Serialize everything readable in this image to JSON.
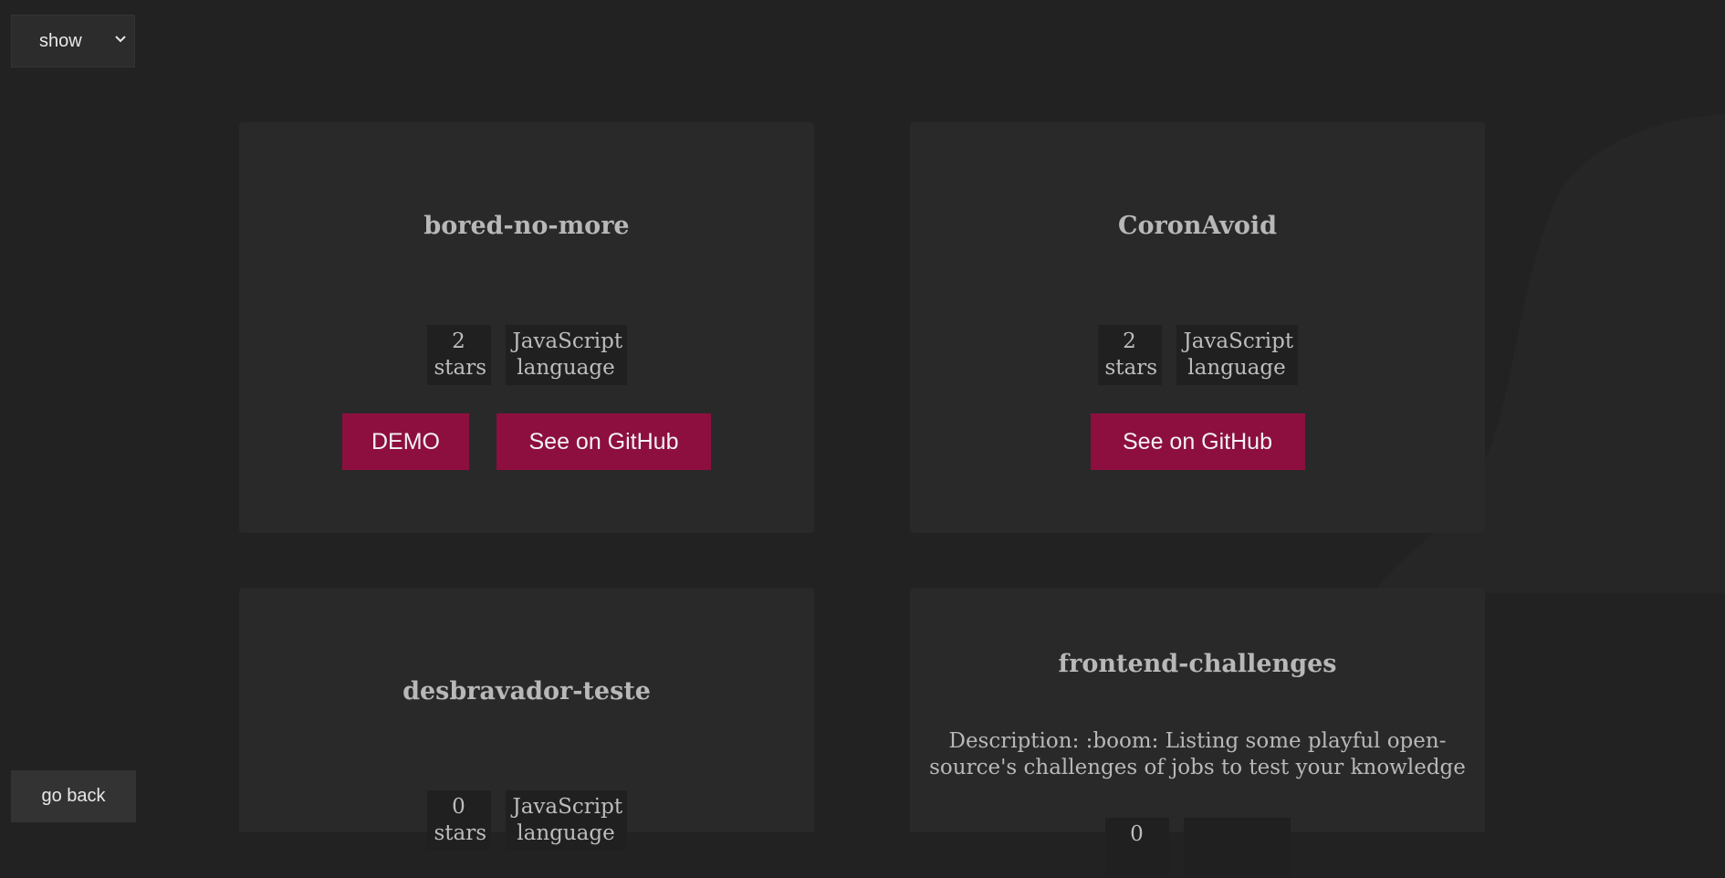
{
  "controls": {
    "show_label": "show",
    "go_back_label": "go back"
  },
  "projects": [
    {
      "title": "bored-no-more",
      "stars_count": "2",
      "stars_label": "stars",
      "language": "JavaScript",
      "language_label": "language",
      "demo_label": "DEMO",
      "github_label": "See on GitHub"
    },
    {
      "title": "CoronAvoid",
      "stars_count": "2",
      "stars_label": "stars",
      "language": "JavaScript",
      "language_label": "language",
      "github_label": "See on GitHub"
    },
    {
      "title": "desbravador-teste",
      "stars_count": "0",
      "stars_label": "stars",
      "language": "JavaScript",
      "language_label": "language"
    },
    {
      "title": "frontend-challenges",
      "description": "Description: :boom: Listing some playful open-source's challenges of jobs to test your knowledge",
      "stars_count": "0"
    }
  ],
  "colors": {
    "background": "#222222",
    "card": "#292929",
    "button": "#8d0f3f",
    "badge": "#202020"
  }
}
